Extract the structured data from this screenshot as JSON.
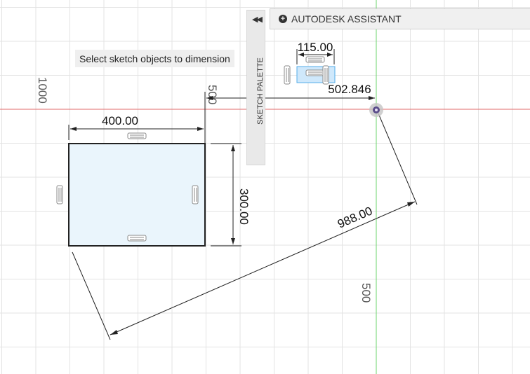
{
  "assistant": {
    "label": "AUTODESK ASSISTANT",
    "icon": "plus-circle-icon"
  },
  "palette": {
    "label": "SKETCH PALETTE",
    "collapse_icon": "double-chevron-left-icon"
  },
  "hint": "Select sketch objects to dimension",
  "axis_labels": {
    "y_1000": "1000",
    "x_500": "500",
    "y_500": "500"
  },
  "dimensions": {
    "width": "400.00",
    "height": "300.00",
    "diagonal": "988.00",
    "horizontal": "502.846",
    "small": "115.00"
  },
  "colors": {
    "grid": "#e3e3e3",
    "x_axis": "#e06a6a",
    "y_axis": "#6ed46e",
    "profile_fill": "#eaf5fc",
    "constraint": "#8a8a8a"
  }
}
